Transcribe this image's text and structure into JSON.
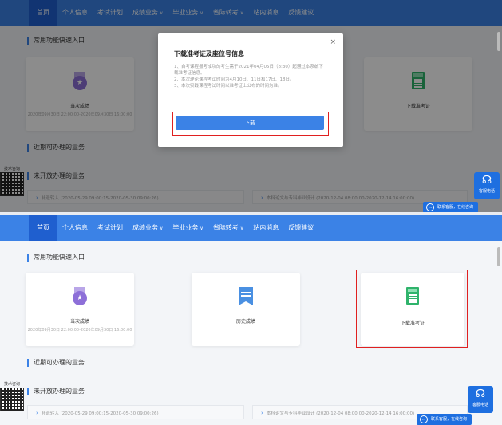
{
  "nav": {
    "items": [
      {
        "label": "首页",
        "active": true,
        "dropdown": false
      },
      {
        "label": "个人信息",
        "dropdown": false
      },
      {
        "label": "考试计划",
        "dropdown": false
      },
      {
        "label": "成绩业务",
        "dropdown": true
      },
      {
        "label": "毕业业务",
        "dropdown": true
      },
      {
        "label": "省际转考",
        "dropdown": true
      },
      {
        "label": "站内消息",
        "dropdown": false
      },
      {
        "label": "反馈建议",
        "dropdown": false
      }
    ],
    "caret": "∨"
  },
  "sections": {
    "common": "常用功能快速入口",
    "available": "近期可办理的业务",
    "not_open": "未开放办理的业务"
  },
  "cards": {
    "current_score": {
      "label": "当次成绩",
      "period": "2020年09月30日 22:00:00-2020年09月30日 16:00:00",
      "icon": "medal-icon"
    },
    "history_score": {
      "label": "历史成绩",
      "icon": "ribbon-flag-icon"
    },
    "admission_ticket": {
      "label": "下载准考证",
      "icon": "admission-ticket-icon"
    }
  },
  "bottom_items": [
    {
      "label": "补退转入",
      "period": "(2020-05-29 09:00:15-2020-05-30 09:00:26)"
    },
    {
      "label": "本科论文与专科毕业设计",
      "period": "(2020-12-04 08:00:00-2020-12-14 16:00:00)"
    }
  ],
  "side": {
    "consult_label": "技术咨询",
    "hotline_label": "客服电话",
    "hotline_icon": "headset-icon",
    "contact_label": "联系客服，在线咨询"
  },
  "modal": {
    "title": "下载准考证及座位号信息",
    "close": "×",
    "lines": [
      "1、自考课程报考成功的考生需于2021年04月05日（8:30）起通过本系统下载准考证信息。",
      "2、本次理论课程考试时间为4月10日、11日和17日、18日。",
      "3、本次实践课程考试时间以准考证上公布的时间为准。"
    ],
    "button": "下载"
  },
  "colors": {
    "brand": "#3b82e6",
    "highlight": "#e02020"
  }
}
